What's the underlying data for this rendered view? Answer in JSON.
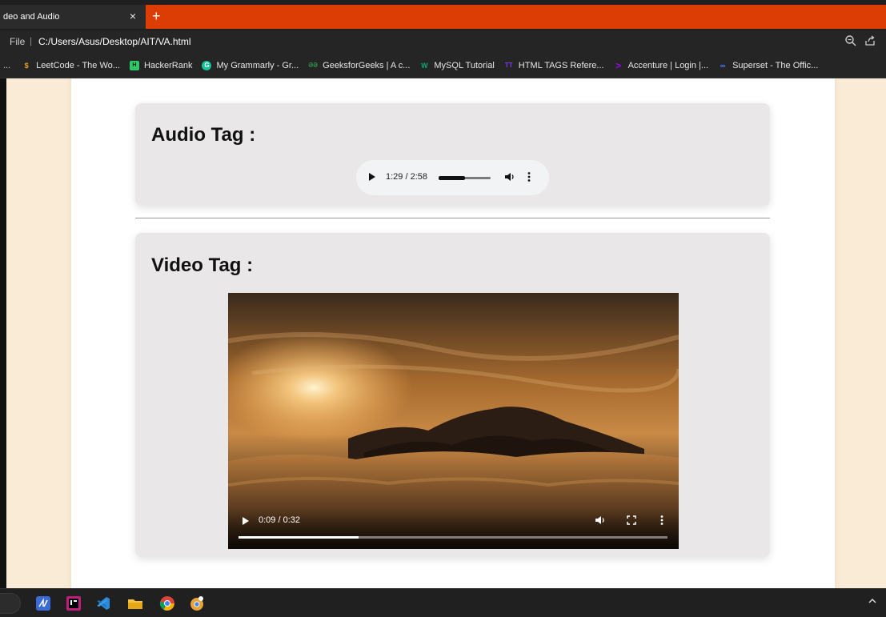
{
  "browser": {
    "tab_title": "deo and Audio",
    "tab_close": "×",
    "new_tab": "+",
    "address": {
      "scheme_label": "File",
      "separator": "|",
      "url": "C:/Users/Asus/Desktop/AIT/VA.html"
    },
    "bookmarks_overflow": "...",
    "bookmarks": [
      {
        "label": "LeetCode - The Wo...",
        "icon": "leetcode-icon",
        "color": "#f0a020"
      },
      {
        "label": "HackerRank",
        "icon": "hackerrank-icon",
        "color": "#2ec866"
      },
      {
        "label": "My Grammarly - Gr...",
        "icon": "grammarly-icon",
        "color": "#15c39a"
      },
      {
        "label": "GeeksforGeeks | A c...",
        "icon": "geeksforgeeks-icon",
        "color": "#2f8d46"
      },
      {
        "label": "MySQL Tutorial",
        "icon": "w3schools-icon",
        "color": "#04aa6d"
      },
      {
        "label": "HTML TAGS Refere...",
        "icon": "html-tags-icon",
        "color": "#7a3cff"
      },
      {
        "label": "Accenture | Login |...",
        "icon": "accenture-icon",
        "color": "#a100ff"
      },
      {
        "label": "Superset - The Offic...",
        "icon": "superset-icon",
        "color": "#4a7cff"
      }
    ]
  },
  "page": {
    "audio_section": {
      "heading": "Audio Tag :",
      "player": {
        "time": "1:29 / 2:58",
        "progress": 0.5
      }
    },
    "video_section": {
      "heading": "Video Tag :",
      "player": {
        "time": "0:09 / 0:32",
        "progress": 0.28
      }
    }
  },
  "taskbar": {
    "apps": [
      "jetbrains-icon",
      "intellij-icon",
      "vscode-icon",
      "file-explorer-icon",
      "chrome-icon",
      "chrome-canary-icon"
    ]
  },
  "colors": {
    "tab_accent": "#dc3d05",
    "page_background": "#faebd7",
    "card_background": "#e9e7e8"
  }
}
